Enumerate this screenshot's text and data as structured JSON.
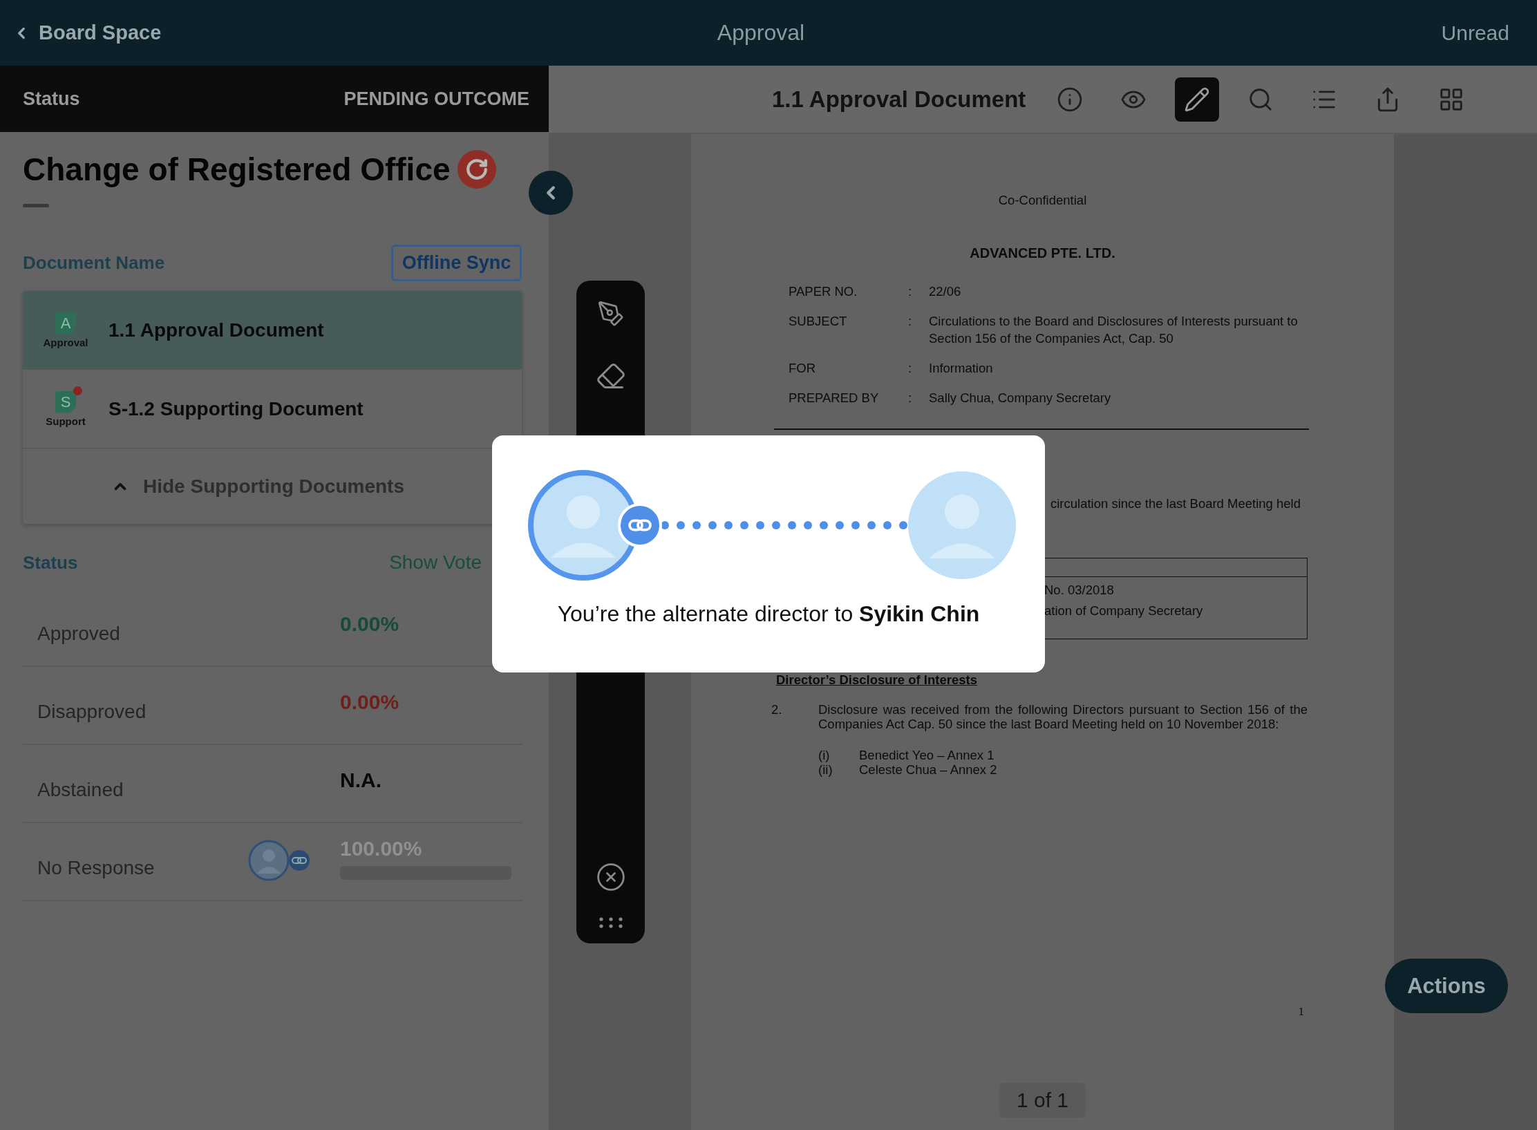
{
  "top_bar": {
    "back_label": "Board Space",
    "title": "Approval",
    "right_label": "Unread"
  },
  "status_bar": {
    "label": "Status",
    "value": "PENDING OUTCOME"
  },
  "item": {
    "title": "Change of Registered Office"
  },
  "documents": {
    "heading": "Document Name",
    "sync_button": "Offline Sync",
    "toggle": "Hide Supporting Documents",
    "items": [
      {
        "badge_letter": "A",
        "badge_label": "Approval",
        "title": "1.1 Approval Document",
        "selected": true,
        "unread": false
      },
      {
        "badge_letter": "S",
        "badge_label": "Support",
        "title": "S-1.2 Supporting Document",
        "selected": false,
        "unread": true
      }
    ]
  },
  "votes": {
    "heading": "Status",
    "link": "Show Vote",
    "rows": [
      {
        "kind": "approved",
        "label": "Approved",
        "value": "0.00%",
        "alternate": false
      },
      {
        "kind": "disapproved",
        "label": "Disapproved",
        "value": "0.00%",
        "alternate": false
      },
      {
        "kind": "abstained",
        "label": "Abstained",
        "value": "N.A.",
        "alternate": false
      },
      {
        "kind": "no_response",
        "label": "No Response",
        "value": "100.00%",
        "alternate": true,
        "level": 1
      }
    ]
  },
  "viewer": {
    "title": "1.1 Approval Document",
    "tools": [
      {
        "kind": "info",
        "selected": false
      },
      {
        "kind": "eye",
        "selected": false
      },
      {
        "kind": "pen",
        "selected": true
      },
      {
        "kind": "search",
        "selected": false
      },
      {
        "kind": "list",
        "selected": false
      },
      {
        "kind": "share",
        "selected": false
      },
      {
        "kind": "grid",
        "selected": false
      }
    ]
  },
  "document": {
    "confidential": "Co-Confidential",
    "company": "ADVANCED PTE. LTD.",
    "fields": [
      {
        "label": "PAPER NO.",
        "colon": ":",
        "value": "22/06"
      },
      {
        "label": "SUBJECT",
        "colon": ":",
        "value": "Circulations to the Board and Disclosures of Interests pursuant to Section 156 of the Companies Act, Cap. 50"
      },
      {
        "label": "FOR",
        "colon": ":",
        "value": "Information"
      },
      {
        "label": "PREPARED BY",
        "colon": ":",
        "value": "Sally Chua, Company Secretary"
      }
    ],
    "section_1_tail": "circulation since the last Board Meeting held",
    "table_rows": [
      "No. 03/2018",
      "ation of Company Secretary"
    ],
    "section_heading": "Director’s Disclosure of Interests",
    "paragraph": {
      "number": "2.",
      "text": "Disclosure was received from the following Directors pursuant to Section 156 of the Companies Act Cap. 50 since the last Board Meeting held on 10 November 2018:"
    },
    "list": [
      {
        "marker": "(i)",
        "text": "Benedict Yeo – Annex 1"
      },
      {
        "marker": "(ii)",
        "text": "Celeste Chua – Annex 2"
      }
    ],
    "page_number": "1"
  },
  "pager": "1 of 1",
  "actions_button": "Actions",
  "dialog": {
    "message": "You’re the alternate director to **Syikin Chin**"
  }
}
